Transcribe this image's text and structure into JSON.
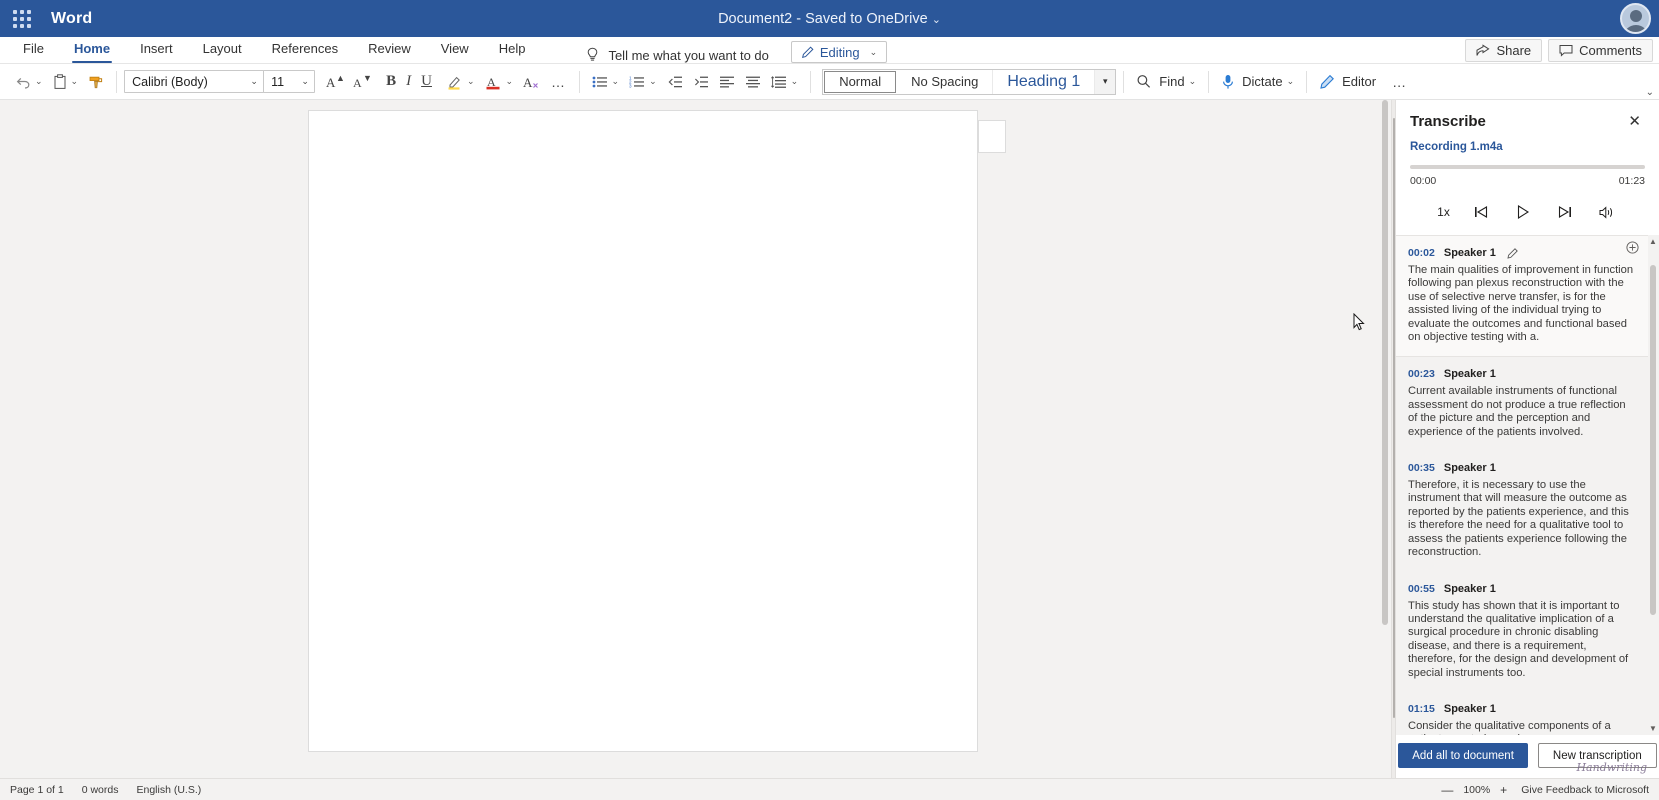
{
  "titlebar": {
    "app_name": "Word",
    "document_title": "Document2",
    "save_state": "Saved to OneDrive",
    "separator": "-",
    "waffle_icon": "app-launcher-icon",
    "avatar_icon": "user-avatar",
    "brand_color": "#2b579a"
  },
  "ribbon": {
    "tabs": [
      {
        "label": "File",
        "active": false
      },
      {
        "label": "Home",
        "active": true
      },
      {
        "label": "Insert",
        "active": false
      },
      {
        "label": "Layout",
        "active": false
      },
      {
        "label": "References",
        "active": false
      },
      {
        "label": "Review",
        "active": false
      },
      {
        "label": "View",
        "active": false
      },
      {
        "label": "Help",
        "active": false
      }
    ],
    "tell_me": "Tell me what you want to do",
    "tell_me_icon": "lightbulb-icon",
    "editing_mode": "Editing",
    "editing_icon": "pencil-icon",
    "share": "Share",
    "share_icon": "share-icon",
    "comments": "Comments",
    "comments_icon": "comment-icon",
    "collapse_icon": "chevron-up-icon"
  },
  "toolbar": {
    "undo": "undo-icon",
    "paste": "paste-icon",
    "format_painter": "format-painter-icon",
    "font_name": "Calibri (Body)",
    "font_size": "11",
    "grow_font": "A",
    "shrink_font": "A",
    "bold": "B",
    "italic": "I",
    "underline": "U",
    "highlight": "highlighter-icon",
    "font_color": "A",
    "clear_formatting": "clear-formatting-icon",
    "more_font": "…",
    "bullets": "bullet-list-icon",
    "numbering": "numbered-list-icon",
    "decrease_indent": "decrease-indent-icon",
    "increase_indent": "increase-indent-icon",
    "align_left": "align-left-icon",
    "align_justify": "align-justify-icon",
    "line_spacing": "line-spacing-icon",
    "styles": [
      {
        "label": "Normal",
        "selected": true
      },
      {
        "label": "No Spacing",
        "selected": false
      },
      {
        "label": "Heading 1",
        "selected": false
      }
    ],
    "styles_more": "▾",
    "find": "Find",
    "find_icon": "search-icon",
    "dictate": "Dictate",
    "dictate_icon": "microphone-icon",
    "editor": "Editor",
    "editor_icon": "editor-icon",
    "overflow": "…"
  },
  "transcribe": {
    "title": "Transcribe",
    "close_icon": "close-icon",
    "recording_name": "Recording 1.m4a",
    "time_current": "00:00",
    "time_total": "01:23",
    "progress_percent": 0,
    "controls": {
      "speed": "1x",
      "rewind": "skip-back-icon",
      "play": "play-icon",
      "forward": "skip-forward-icon",
      "volume": "volume-icon"
    },
    "entries": [
      {
        "time": "00:02",
        "speaker": "Speaker 1",
        "text": "The main qualities of improvement in function following pan plexus reconstruction with the use of selective nerve transfer, is for the assisted living of the individual trying to evaluate the outcomes and functional based on objective testing with a.",
        "active": true,
        "edit_icon": "pencil-icon",
        "add_icon": "add-circle-icon"
      },
      {
        "time": "00:23",
        "speaker": "Speaker 1",
        "text": "Current available instruments of functional assessment do not produce a true reflection of the picture and the perception and experience of the patients involved.",
        "active": false
      },
      {
        "time": "00:35",
        "speaker": "Speaker 1",
        "text": "Therefore, it is necessary to use the instrument that will measure the outcome as reported by the patients experience, and this is therefore the need for a qualitative tool to assess the patients experience following the reconstruction.",
        "active": false
      },
      {
        "time": "00:55",
        "speaker": "Speaker 1",
        "text": "This study has shown that it is important to understand the qualitative implication of a surgical procedure in chronic disabling disease, and there is a requirement, therefore, for the design and development of special instruments too.",
        "active": false
      },
      {
        "time": "01:15",
        "speaker": "Speaker 1",
        "text": "Consider the qualitative components of a patient reported experience measure.",
        "active": false
      }
    ],
    "add_all_button": "Add all to document",
    "new_transcription_button": "New transcription"
  },
  "status": {
    "page": "Page 1 of 1",
    "words": "0 words",
    "language": "English (U.S.)",
    "zoom": "100%",
    "zoom_out_icon": "minus-icon",
    "zoom_in_icon": "plus-icon",
    "feedback": "Give Feedback to Microsoft",
    "signature": "Handwriting"
  }
}
